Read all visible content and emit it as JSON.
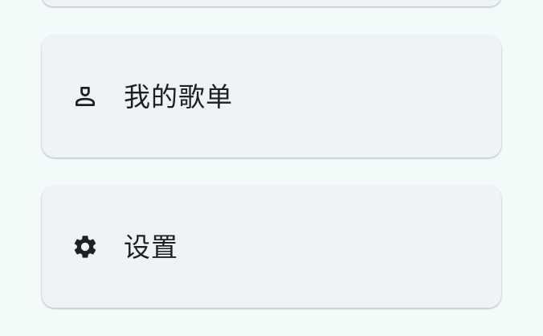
{
  "colors": {
    "background": "#f2fafa",
    "card": "#f0f3f6",
    "text": "#1d1f22",
    "icon": "#1d1f22"
  },
  "menu": {
    "items": [
      {
        "label": "我的歌单",
        "icon": "person-icon"
      },
      {
        "label": "设置",
        "icon": "gear-icon"
      }
    ]
  }
}
